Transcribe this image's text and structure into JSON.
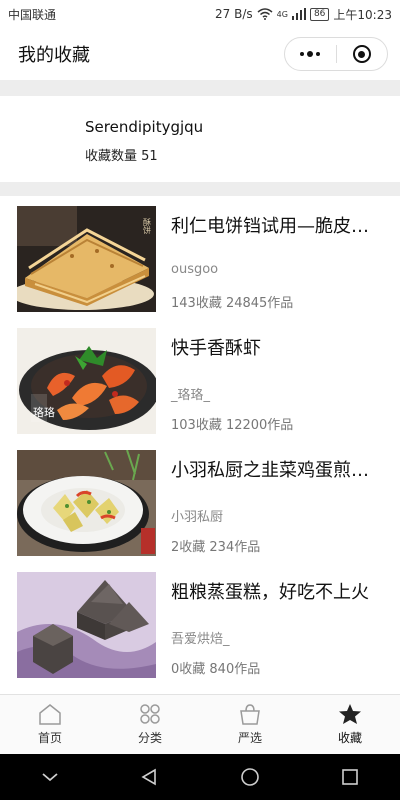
{
  "status_bar": {
    "carrier": "中国联通",
    "speed": "27 B/s",
    "network": "4G",
    "battery": "86",
    "time": "上午10:23"
  },
  "nav": {
    "title": "我的收藏",
    "more_icon": "more-dots-icon",
    "close_icon": "target-icon"
  },
  "profile": {
    "username": "Serendipitygjqu",
    "favorite_count": "收藏数量 51"
  },
  "items": [
    {
      "title": "利仁电饼铛试用—脆皮…",
      "author": "ousgoo",
      "stats": "143收藏 24845作品"
    },
    {
      "title": "快手香酥虾",
      "author": "_珞珞_",
      "stats": "103收藏 12200作品"
    },
    {
      "title": "小羽私厨之韭菜鸡蛋煎…",
      "author": "小羽私厨",
      "stats": "2收藏 234作品"
    },
    {
      "title": "粗粮蒸蛋糕，好吃不上火",
      "author": "吾爱烘焙_",
      "stats": "0收藏 840作品"
    }
  ],
  "thumb_marks": [
    "酥饼",
    "珞珞"
  ],
  "tabs": [
    {
      "label": "首页",
      "icon": "home-icon",
      "active": false
    },
    {
      "label": "分类",
      "icon": "category-icon",
      "active": false
    },
    {
      "label": "严选",
      "icon": "bag-icon",
      "active": false
    },
    {
      "label": "收藏",
      "icon": "star-icon",
      "active": true
    }
  ],
  "colors": {
    "divider_gray": "#ededed",
    "text_primary": "#111111",
    "text_secondary": "#888888",
    "active_icon": "#222222"
  }
}
